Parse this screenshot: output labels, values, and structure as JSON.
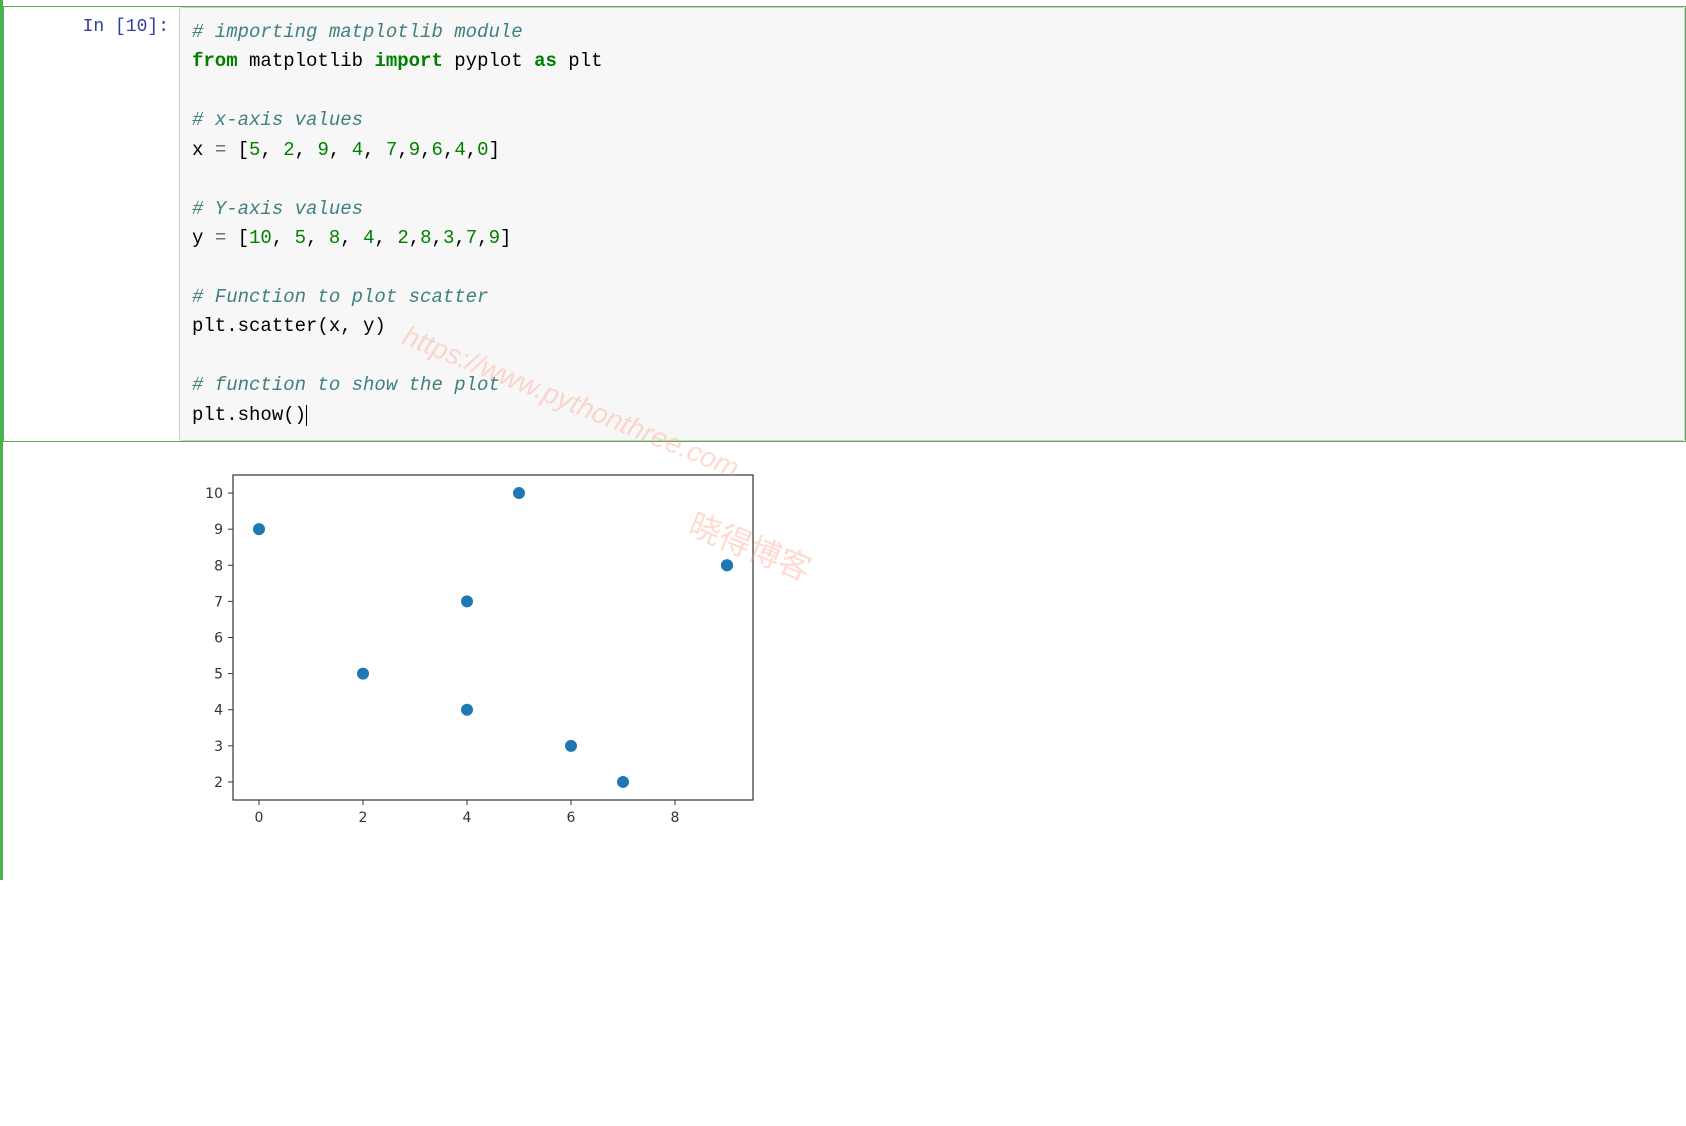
{
  "cell": {
    "prompt_label": "In [10]:",
    "code_lines": [
      {
        "type": "comment",
        "text": "# importing matplotlib module"
      },
      {
        "type": "import",
        "kw1": "from",
        "mod": " matplotlib ",
        "kw2": "import",
        "rest": " pyplot ",
        "kw3": "as",
        "alias": " plt"
      },
      {
        "type": "blank",
        "text": ""
      },
      {
        "type": "comment",
        "text": "# x-axis values"
      },
      {
        "type": "assign",
        "name": "x ",
        "op": "=",
        "list": " [5, 2, 9, 4, 7,9,6,4,0]"
      },
      {
        "type": "blank",
        "text": ""
      },
      {
        "type": "comment",
        "text": "# Y-axis values"
      },
      {
        "type": "assign",
        "name": "y ",
        "op": "=",
        "list": " [10, 5, 8, 4, 2,8,3,7,9]"
      },
      {
        "type": "blank",
        "text": ""
      },
      {
        "type": "comment",
        "text": "# Function to plot scatter"
      },
      {
        "type": "call",
        "text": "plt.scatter(x, y)"
      },
      {
        "type": "blank",
        "text": ""
      },
      {
        "type": "comment",
        "text": "# function to show the plot"
      },
      {
        "type": "call_cursor",
        "text": "plt.show()"
      }
    ]
  },
  "watermark": {
    "line1": "https://www.pythonthree.com",
    "line2": "晓得博客"
  },
  "chart_data": {
    "type": "scatter",
    "x": [
      5,
      2,
      9,
      4,
      7,
      9,
      6,
      4,
      0
    ],
    "y": [
      10,
      5,
      8,
      4,
      2,
      8,
      3,
      7,
      9
    ],
    "x_ticks": [
      0,
      2,
      4,
      6,
      8
    ],
    "y_ticks": [
      2,
      3,
      4,
      5,
      6,
      7,
      8,
      9,
      10
    ],
    "xlim": [
      -0.5,
      9.5
    ],
    "ylim": [
      1.5,
      10.5
    ],
    "title": "",
    "xlabel": "",
    "ylabel": ""
  }
}
